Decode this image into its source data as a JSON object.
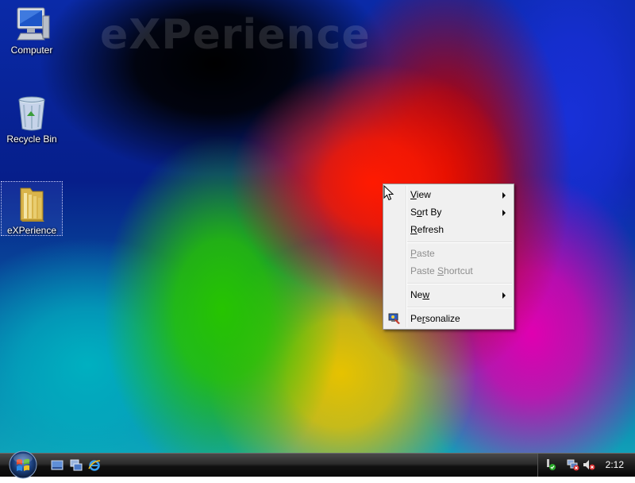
{
  "desktop": {
    "watermark": "eXPerience",
    "icons": [
      {
        "label": "Computer",
        "icon": "computer-icon"
      },
      {
        "label": "Recycle Bin",
        "icon": "recycle-bin-icon"
      },
      {
        "label": "eXPerience",
        "icon": "folder-icon",
        "selected": true
      }
    ]
  },
  "context_menu": {
    "items": [
      {
        "pre": "",
        "accel": "V",
        "post": "iew",
        "submenu": true,
        "enabled": true
      },
      {
        "pre": "S",
        "accel": "o",
        "post": "rt By",
        "submenu": true,
        "enabled": true
      },
      {
        "pre": "",
        "accel": "R",
        "post": "efresh",
        "submenu": false,
        "enabled": true
      },
      {
        "pre": "",
        "accel": "P",
        "post": "aste",
        "submenu": false,
        "enabled": false
      },
      {
        "pre": "Paste ",
        "accel": "S",
        "post": "hortcut",
        "submenu": false,
        "enabled": false
      },
      {
        "pre": "Ne",
        "accel": "w",
        "post": "",
        "submenu": true,
        "enabled": true
      },
      {
        "pre": "Pe",
        "accel": "r",
        "post": "sonalize",
        "submenu": false,
        "enabled": true,
        "icon": "personalize-icon"
      }
    ]
  },
  "taskbar": {
    "start": "start-orb-icon",
    "quick_launch": [
      "show-desktop-icon",
      "switch-windows-icon",
      "internet-explorer-icon"
    ],
    "tray_icons": [
      "security-center-icon",
      "network-disconnected-icon",
      "volume-muted-icon"
    ],
    "clock": "2:12"
  },
  "colors": {
    "menu_background": "#f0f0f0",
    "menu_disabled_text": "#8d8d8d",
    "taskbar": "#1a1a1a"
  }
}
